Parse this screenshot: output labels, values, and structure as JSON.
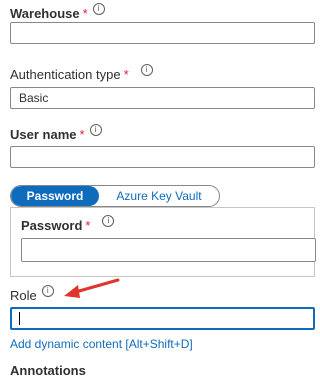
{
  "fields": {
    "warehouse": {
      "label": "Warehouse",
      "required": "*",
      "info": "i"
    },
    "auth_type": {
      "label": "Authentication type",
      "required": "*",
      "info": "i",
      "value": "Basic"
    },
    "user_name": {
      "label": "User name",
      "required": "*",
      "info": "i"
    },
    "password": {
      "label": "Password",
      "required": "*",
      "info": "i"
    },
    "role": {
      "label": "Role",
      "info": "i",
      "value": ""
    }
  },
  "toggle": {
    "options": [
      "Password",
      "Azure Key Vault"
    ],
    "selected": "Password"
  },
  "links": {
    "dynamic_content": "Add dynamic content [Alt+Shift+D]"
  },
  "sections": {
    "annotations": "Annotations"
  },
  "colors": {
    "accent": "#0f6cbd",
    "required": "#e31b3b",
    "annotation_arrow": "#e0352b"
  }
}
